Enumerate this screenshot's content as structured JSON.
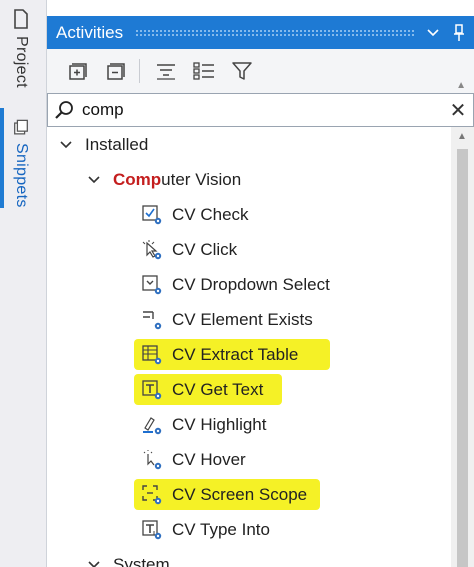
{
  "side_tabs": {
    "project": "Project",
    "snippets": "Snippets"
  },
  "panel": {
    "title": "Activities",
    "pin_icon": "pin-icon",
    "dropdown_icon": "chevron-down-icon"
  },
  "toolbar": {
    "buttons": [
      "expand-all-icon",
      "collapse-all-icon",
      "sort-icon",
      "list-view-icon",
      "filter-icon"
    ]
  },
  "search": {
    "value": "comp",
    "clear_symbol": "✕"
  },
  "tree": {
    "installed_label": "Installed",
    "category": {
      "match_part": "Comp",
      "rest_part": "uter Vision"
    },
    "items": [
      {
        "label": "CV Check",
        "icon": "cv-check-icon",
        "highlighted": false
      },
      {
        "label": "CV Click",
        "icon": "cv-click-icon",
        "highlighted": false
      },
      {
        "label": "CV Dropdown Select",
        "icon": "cv-dropdown-select-icon",
        "highlighted": false
      },
      {
        "label": "CV Element Exists",
        "icon": "cv-element-exists-icon",
        "highlighted": false
      },
      {
        "label": "CV Extract Table",
        "icon": "cv-extract-table-icon",
        "highlighted": true
      },
      {
        "label": "CV Get Text",
        "icon": "cv-get-text-icon",
        "highlighted": true
      },
      {
        "label": "CV Highlight",
        "icon": "cv-highlight-icon",
        "highlighted": false
      },
      {
        "label": "CV Hover",
        "icon": "cv-hover-icon",
        "highlighted": false
      },
      {
        "label": "CV Screen Scope",
        "icon": "cv-screen-scope-icon",
        "highlighted": true
      },
      {
        "label": "CV Type Into",
        "icon": "cv-type-into-icon",
        "highlighted": false
      }
    ],
    "next_category": "System"
  },
  "colors": {
    "accent": "#1e7ad4",
    "match_text": "#c41e1e",
    "highlight": "#f4f01a"
  }
}
